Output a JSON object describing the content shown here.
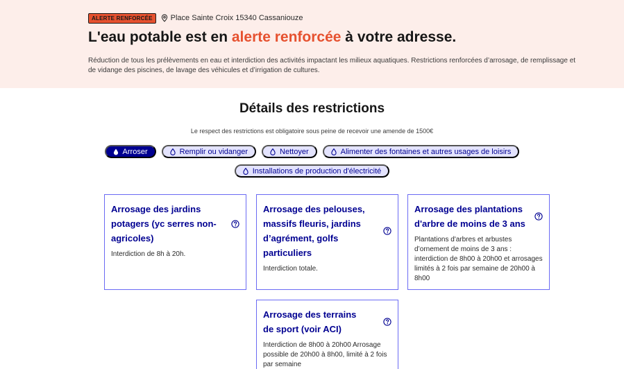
{
  "alert": {
    "badge": "ALERTE RENFORCÉE",
    "location": "Place Sainte Croix 15340 Cassaniouze",
    "headline_prefix": "L'eau potable est en ",
    "headline_accent": "alerte renforcée",
    "headline_suffix": " à votre adresse.",
    "description": "Réduction de tous les prélèvements en eau et interdiction des activités impactant les milieux aquatiques. Restrictions renforcées d’arrosage, de remplissage et de vidange des piscines, de lavage des véhicules et d’irrigation de cultures.",
    "accent_color": "#e6512f"
  },
  "restrictions": {
    "title": "Détails des restrictions",
    "notice": "Le respect des restrictions est obligatoire sous peine de recevoir une amende de 1500€",
    "chips": [
      {
        "label": "Arroser",
        "active": true
      },
      {
        "label": "Remplir ou vidanger",
        "active": false
      },
      {
        "label": "Nettoyer",
        "active": false
      },
      {
        "label": "Alimenter des fontaines et autres usages de loisirs",
        "active": false
      },
      {
        "label": "Installations de production d'électricité",
        "active": false
      }
    ],
    "cards": [
      {
        "title": "Arrosage des jardins potagers (yc serres non-agricoles)",
        "text": "Interdiction de 8h à 20h."
      },
      {
        "title": "Arrosage des pelouses, massifs fleuris, jardins d’agrément, golfs particuliers",
        "text": "Interdiction totale."
      },
      {
        "title": "Arrosage des plantations d'arbre de moins de 3 ans",
        "text": "Plantations d'arbres et arbustes d’ornement de moins de 3 ans : interdiction de 8h00 à 20h00 et arrosages limités à 2 fois par semaine de 20h00 à 8h00"
      },
      {
        "title": "Arrosage des terrains de sport (voir ACI)",
        "text": "Interdiction de 8h00 à 20h00 Arrosage possible de 20h00 à 8h00, limité à 2 fois par semaine"
      }
    ],
    "primary_color": "#000091"
  }
}
